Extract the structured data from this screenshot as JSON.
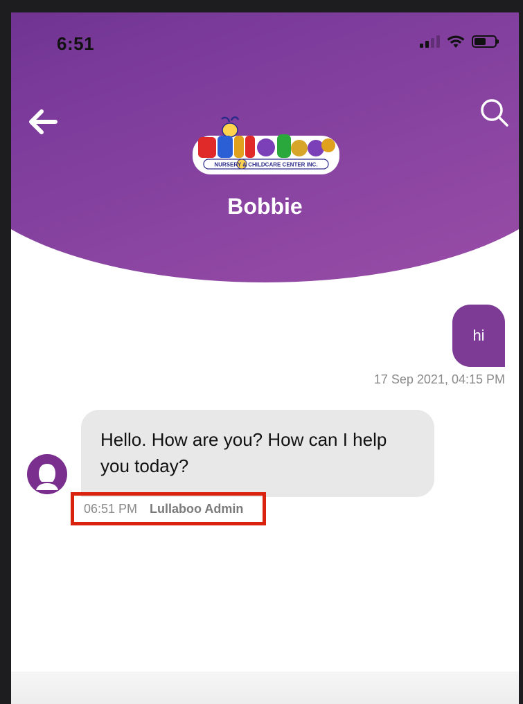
{
  "status_bar": {
    "time": "6:51"
  },
  "header": {
    "back_icon": "arrow-left-icon",
    "search_icon": "search-icon",
    "logo": {
      "name": "Lullaboo",
      "tagline": "NURSERY & CHILDCARE CENTER INC."
    },
    "title": "Bobbie"
  },
  "messages": [
    {
      "direction": "outgoing",
      "text": "hi",
      "timestamp": "17 Sep 2021, 04:15 PM"
    },
    {
      "direction": "incoming",
      "text": "Hello. How are you? How can I help you today?",
      "time": "06:51 PM",
      "sender": "Lullaboo Admin"
    }
  ],
  "colors": {
    "header_purple": "#6b2f8c",
    "outgoing_bubble": "#7d3b95",
    "incoming_bubble": "#e8e8e8",
    "highlight_box": "#d9230f"
  }
}
